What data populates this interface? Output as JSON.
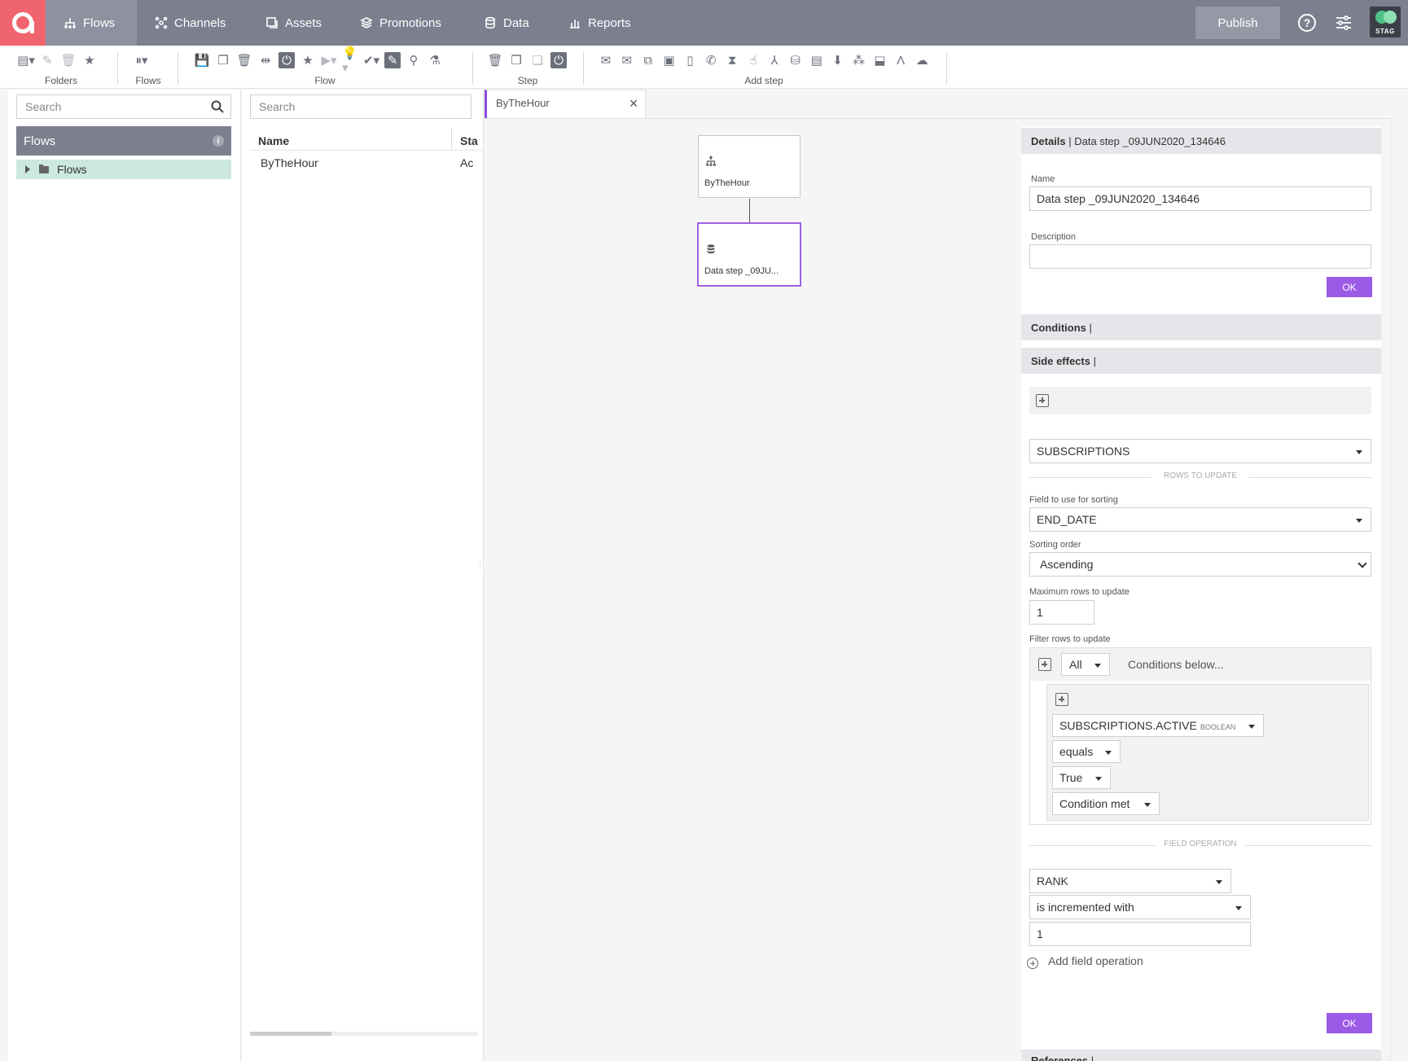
{
  "nav": {
    "items": [
      {
        "label": "Flows",
        "icon": "flows-icon"
      },
      {
        "label": "Channels",
        "icon": "channels-icon"
      },
      {
        "label": "Assets",
        "icon": "assets-icon"
      },
      {
        "label": "Promotions",
        "icon": "promotions-icon"
      },
      {
        "label": "Data",
        "icon": "data-icon"
      },
      {
        "label": "Reports",
        "icon": "reports-icon"
      }
    ],
    "publish": "Publish",
    "env": "STAG"
  },
  "toolbar": {
    "folders": "Folders",
    "flows": "Flows",
    "flow": "Flow",
    "step": "Step",
    "add_step": "Add step"
  },
  "left": {
    "search_placeholder": "Search",
    "header": "Flows",
    "tree_item": "Flows"
  },
  "list": {
    "search_placeholder": "Search",
    "col_name": "Name",
    "col_status": "Sta",
    "rows": [
      {
        "name": "ByTheHour",
        "status": "Ac"
      }
    ]
  },
  "tab": {
    "label": "ByTheHour"
  },
  "canvas": {
    "nodes": [
      {
        "label": "ByTheHour"
      },
      {
        "label": "Data step _09JU..."
      }
    ]
  },
  "details": {
    "header_bold": "Details",
    "header_rest": " | Data step _09JUN2020_134646",
    "name_label": "Name",
    "name_value": "Data step _09JUN2020_134646",
    "description_label": "Description",
    "description_value": "",
    "ok": "OK",
    "conditions": "Conditions",
    "side_effects": "Side effects",
    "separator": " |",
    "table": "SUBSCRIPTIONS",
    "rows_to_update": "ROWS TO UPDATE",
    "sort_field_label": "Field to use for sorting",
    "sort_field": "END_DATE",
    "sort_order_label": "Sorting order",
    "sort_order": "Ascending",
    "max_rows_label": "Maximum rows to update",
    "max_rows": "1",
    "filter_label": "Filter rows to update",
    "filter_mode": "All",
    "conditions_below": "Conditions below...",
    "cond_field": "SUBSCRIPTIONS.ACTIVE",
    "cond_type": "BOOLEAN",
    "cond_operator": "equals",
    "cond_value": "True",
    "cond_result": "Condition met",
    "field_operation": "FIELD OPERATION",
    "op_field": "RANK",
    "op_type": "is incremented with",
    "op_value": "1",
    "add_field_op": "Add field operation",
    "references": "References"
  }
}
